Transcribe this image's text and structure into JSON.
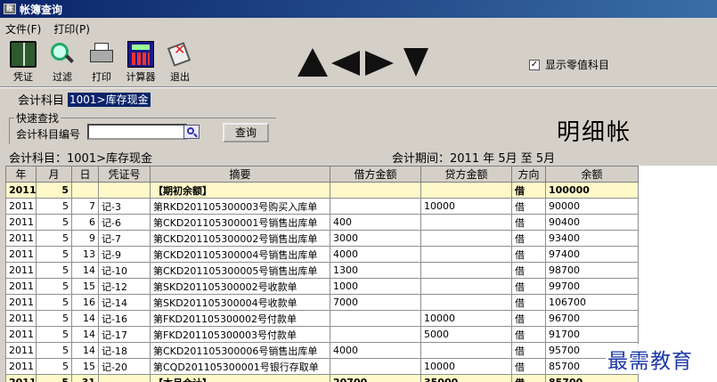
{
  "window": {
    "title": "帐簿查询",
    "icon_text": "账"
  },
  "menu": [
    {
      "label": "文件(F)"
    },
    {
      "label": "打印(P)"
    }
  ],
  "toolbar": [
    {
      "name": "voucher",
      "label": "凭证"
    },
    {
      "name": "filter",
      "label": "过滤"
    },
    {
      "name": "print",
      "label": "打印"
    },
    {
      "name": "calculator",
      "label": "计算器"
    },
    {
      "name": "exit",
      "label": "退出"
    }
  ],
  "show_zero": {
    "label": "显示零值科目",
    "checked": true
  },
  "account": {
    "label": "会计科目",
    "value": "1001>库存现金"
  },
  "quick_search": {
    "title": "快速查找",
    "label": "会计科目编号",
    "value": "",
    "button": "查询"
  },
  "ledger_title": "明细帐",
  "info": {
    "account_text": "会计科目：1001>库存现金",
    "period_text": "会计期间：2011 年 5月 至 5月"
  },
  "columns": [
    "年",
    "月",
    "日",
    "凭证号",
    "摘要",
    "借方金额",
    "贷方金额",
    "方向",
    "余额"
  ],
  "rows": [
    {
      "y": "2011",
      "m": "5",
      "d": "",
      "v": "",
      "desc": "【期初余额】",
      "debit": "",
      "credit": "",
      "dir": "借",
      "bal": "100000",
      "hl": true
    },
    {
      "y": "2011",
      "m": "5",
      "d": "7",
      "v": "记-3",
      "desc": "第RKD201105300003号购买入库单",
      "debit": "",
      "credit": "10000",
      "dir": "借",
      "bal": "90000"
    },
    {
      "y": "2011",
      "m": "5",
      "d": "6",
      "v": "记-6",
      "desc": "第CKD201105300001号销售出库单",
      "debit": "400",
      "credit": "",
      "dir": "借",
      "bal": "90400"
    },
    {
      "y": "2011",
      "m": "5",
      "d": "9",
      "v": "记-7",
      "desc": "第CKD201105300002号销售出库单",
      "debit": "3000",
      "credit": "",
      "dir": "借",
      "bal": "93400"
    },
    {
      "y": "2011",
      "m": "5",
      "d": "13",
      "v": "记-9",
      "desc": "第CKD201105300004号销售出库单",
      "debit": "4000",
      "credit": "",
      "dir": "借",
      "bal": "97400"
    },
    {
      "y": "2011",
      "m": "5",
      "d": "14",
      "v": "记-10",
      "desc": "第CKD201105300005号销售出库单",
      "debit": "1300",
      "credit": "",
      "dir": "借",
      "bal": "98700"
    },
    {
      "y": "2011",
      "m": "5",
      "d": "15",
      "v": "记-12",
      "desc": "第SKD201105300002号收款单",
      "debit": "1000",
      "credit": "",
      "dir": "借",
      "bal": "99700"
    },
    {
      "y": "2011",
      "m": "5",
      "d": "16",
      "v": "记-14",
      "desc": "第SKD201105300004号收款单",
      "debit": "7000",
      "credit": "",
      "dir": "借",
      "bal": "106700"
    },
    {
      "y": "2011",
      "m": "5",
      "d": "14",
      "v": "记-16",
      "desc": "第FKD201105300002号付款单",
      "debit": "",
      "credit": "10000",
      "dir": "借",
      "bal": "96700"
    },
    {
      "y": "2011",
      "m": "5",
      "d": "14",
      "v": "记-17",
      "desc": "第FKD201105300003号付款单",
      "debit": "",
      "credit": "5000",
      "dir": "借",
      "bal": "91700"
    },
    {
      "y": "2011",
      "m": "5",
      "d": "14",
      "v": "记-18",
      "desc": "第CKD201105300006号销售出库单",
      "debit": "4000",
      "credit": "",
      "dir": "借",
      "bal": "95700"
    },
    {
      "y": "2011",
      "m": "5",
      "d": "15",
      "v": "记-20",
      "desc": "第CQD201105300001号银行存取单",
      "debit": "",
      "credit": "10000",
      "dir": "借",
      "bal": "85700"
    },
    {
      "y": "2011",
      "m": "5",
      "d": "31",
      "v": "",
      "desc": "【本月合计】",
      "debit": "20700",
      "credit": "35000",
      "dir": "借",
      "bal": "85700",
      "hl": true
    }
  ],
  "watermark": "最需教育"
}
